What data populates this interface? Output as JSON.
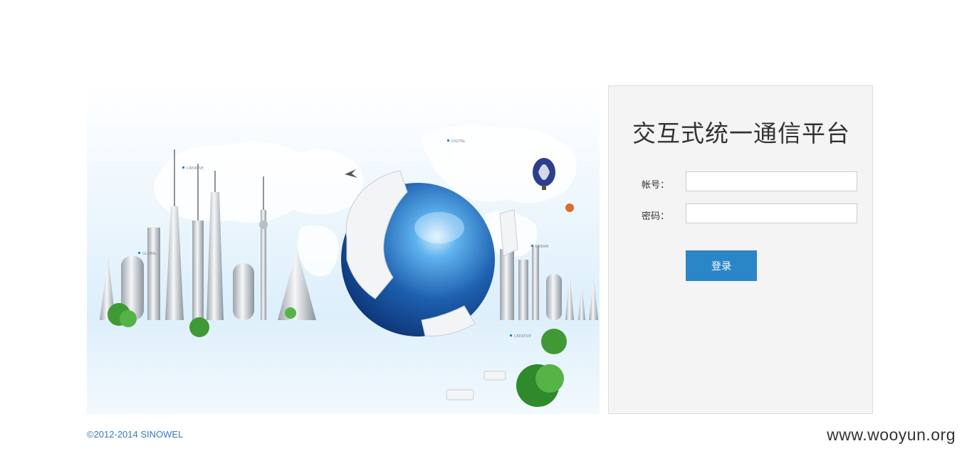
{
  "login": {
    "title": "交互式统一通信平台",
    "username_label": "帐号：",
    "username_value": "",
    "password_label": "密码：",
    "password_value": "",
    "submit_label": "登录"
  },
  "footer": {
    "copyright": "©2012-2014 SINOWEL"
  },
  "watermark": {
    "text": "www.wooyun.org"
  },
  "banner": {
    "map_labels": [
      "GLOBAL",
      "CREATIVE",
      "DIGITAL",
      "DREAM",
      "CREATIVE"
    ]
  },
  "colors": {
    "accent": "#2a86c7",
    "copyright": "#3a78b8",
    "panel_bg": "#f4f4f4",
    "globe": "#1d5fae"
  }
}
